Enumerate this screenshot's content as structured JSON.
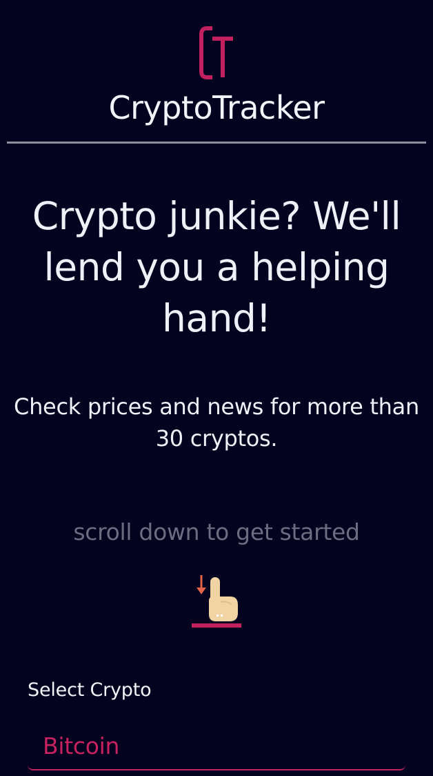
{
  "header": {
    "logo_letters": "CT",
    "title": "CryptoTracker"
  },
  "hero": {
    "title": "Crypto junkie? We'll lend you a helping hand!",
    "subtitle": "Check prices and news for more than 30 cryptos.",
    "scroll_hint": "scroll down to get started"
  },
  "selector": {
    "label": "Select Crypto",
    "selected_value": "Bitcoin"
  },
  "colors": {
    "background": "#03021f",
    "accent": "#c2205f",
    "text": "#f0f0f8",
    "muted_text": "#6d6c80",
    "divider": "#8f8e9c"
  },
  "icons": {
    "logo": "ct-logo-icon",
    "scroll": "hand-pointing-down-icon"
  }
}
